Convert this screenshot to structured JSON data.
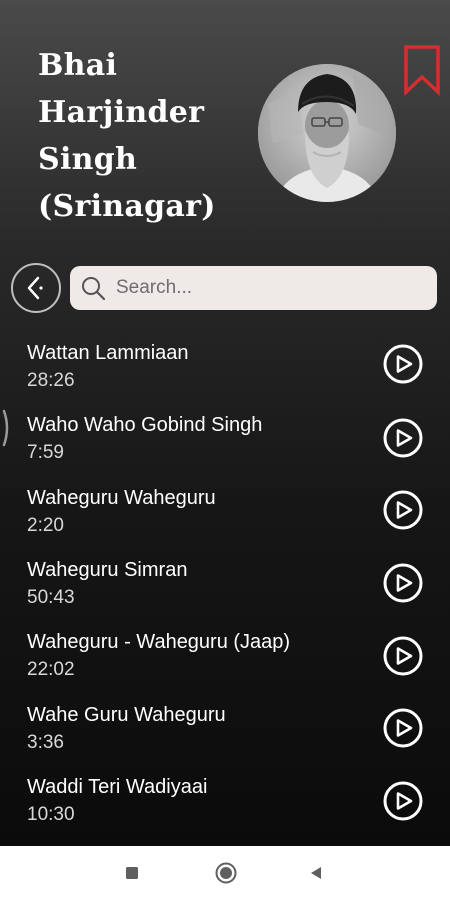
{
  "header": {
    "artist_name": "Bhai\nHarjinder\nSingh\n(Srinagar)",
    "bookmark_color": "#d32f2f"
  },
  "search": {
    "placeholder": "Search..."
  },
  "tracks": [
    {
      "title": "Wattan Lammiaan",
      "duration": "28:26"
    },
    {
      "title": "Waho Waho Gobind Singh",
      "duration": "7:59"
    },
    {
      "title": "Waheguru Waheguru",
      "duration": "2:20"
    },
    {
      "title": "Waheguru Simran",
      "duration": "50:43"
    },
    {
      "title": "Waheguru - Waheguru (Jaap)",
      "duration": "22:02"
    },
    {
      "title": "Wahe Guru Waheguru",
      "duration": "3:36"
    },
    {
      "title": "Waddi Teri Wadiyaai",
      "duration": "10:30"
    }
  ],
  "icons": {
    "back": "back-arrow-icon",
    "search": "search-icon",
    "play": "play-circle-icon",
    "bookmark": "bookmark-icon"
  }
}
